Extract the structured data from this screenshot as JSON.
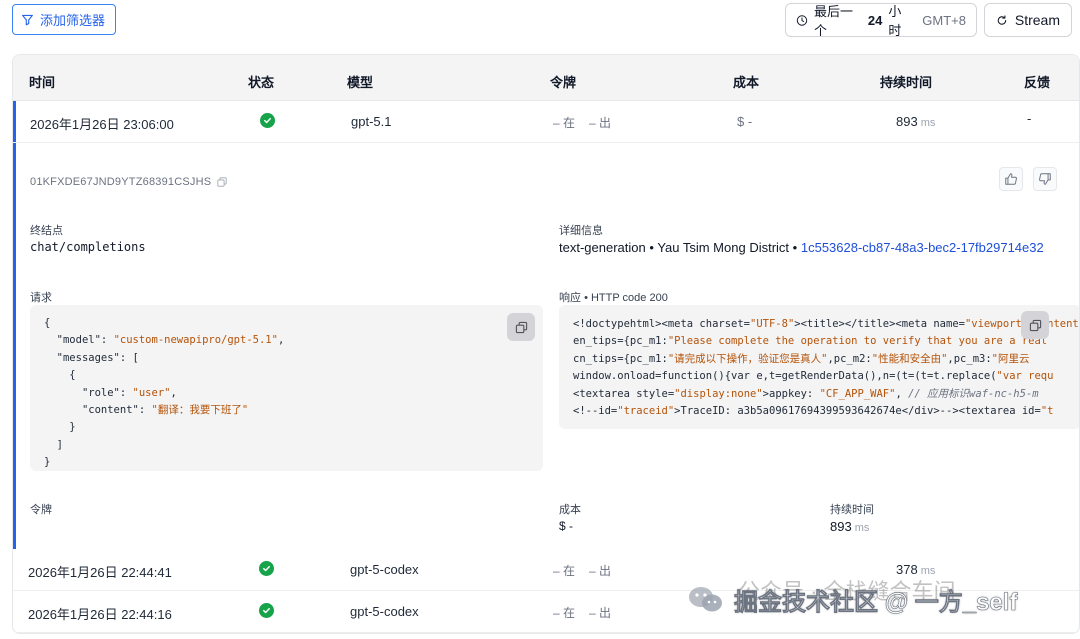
{
  "toolbar": {
    "filter_label": "添加筛选器",
    "time_prefix": "最后一个",
    "time_value": "24",
    "time_suffix": "小时",
    "timezone": "GMT+8",
    "stream_label": "Stream"
  },
  "table": {
    "headers": {
      "time": "时间",
      "status": "状态",
      "model": "模型",
      "tokens": "令牌",
      "cost": "成本",
      "duration": "持续时间",
      "feedback": "反馈"
    },
    "rows": [
      {
        "time": "2026年1月26日 23:06:00",
        "model": "gpt-5.1",
        "tokens_in": "– 在",
        "tokens_out": "– 出",
        "cost": "$ -",
        "duration": "893",
        "duration_unit": "ms",
        "feedback": "-"
      },
      {
        "time": "2026年1月26日 22:44:41",
        "model": "gpt-5-codex",
        "tokens_in": "– 在",
        "tokens_out": "– 出",
        "cost": "",
        "duration": "378",
        "duration_unit": "ms",
        "feedback": ""
      },
      {
        "time": "2026年1月26日 22:44:16",
        "model": "gpt-5-codex",
        "tokens_in": "– 在",
        "tokens_out": "– 出",
        "cost": "",
        "duration": "",
        "duration_unit": "",
        "feedback": ""
      }
    ]
  },
  "detail": {
    "request_id": "01KFXDE67JND9YTZ68391CSJHS",
    "endpoint_label": "终结点",
    "endpoint_value": "chat/completions",
    "info_label": "详细信息",
    "info_type": "text-generation",
    "info_sep": "•",
    "info_region": "Yau Tsim Mong District",
    "info_trace": "1c553628-cb87-48a3-bec2-17fb29714e32",
    "request_label": "请求",
    "response_label": "响应",
    "response_code": "• HTTP code 200",
    "request_lines": {
      "l1": "{",
      "l2_key": "\"model\"",
      "l2_val": "\"custom-newapipro/gpt-5.1\"",
      "l3_key": "\"messages\"",
      "l3_rest": ": [",
      "l4": "{",
      "l5_key": "\"role\"",
      "l5_val": "\"user\"",
      "l6_key": "\"content\"",
      "l6_val": "\"翻译：我要下班了\"",
      "l7": "}",
      "l8": "]",
      "l9": "}"
    },
    "response_lines": {
      "r1a": "<!doctypehtml><meta charset=",
      "r1b": "\"UTF-8\"",
      "r1c": "><title></title><meta name=",
      "r1d": "\"viewport\" content=\"width=",
      "r2a": "en_tips={pc_m1:",
      "r2b": "\"Please complete the operation to verify that you are a real",
      "r3a": "cn_tips={pc_m1:",
      "r3b": "\"请完成以下操作，验证您是真人\"",
      "r3c": ",pc_m2:",
      "r3d": "\"性能和安全由\"",
      "r3e": ",pc_m3:",
      "r3f": "\"阿里云",
      "r4a": "window.onload=function(){var e,t=getRenderData(),n=(t=(t=t.replace(",
      "r4b": "\"var requ",
      "r5a": "<textarea style=",
      "r5b": "\"display:none\"",
      "r5c": ">appkey: ",
      "r5d": "\"CF_APP_WAF\"",
      "r5e": ", ",
      "r5f": "// 应用标识waf-nc-h5-m",
      "r6a": "<!--id=",
      "r6b": "\"traceid\"",
      "r6c": ">TraceID: a3b5a09617694399593642674e</div>--><textarea id=",
      "r6d": "\"t"
    },
    "token_label": "令牌",
    "cost_label": "成本",
    "cost_value": "$ -",
    "duration_label": "持续时间",
    "duration_value": "893",
    "duration_unit": "ms"
  },
  "watermark": {
    "text": "掘金技术社区 @ 一方_self",
    "sub": "公众号 · 全栈缝合车间"
  },
  "colors": {
    "accent": "#2563eb",
    "success": "#16a34a",
    "string": "#b45309"
  }
}
